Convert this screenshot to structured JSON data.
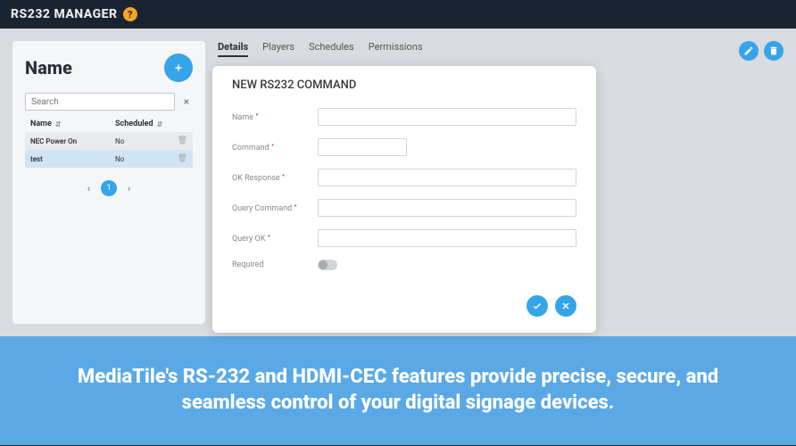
{
  "app": {
    "title": "RS232 MANAGER"
  },
  "leftPanel": {
    "title": "Name",
    "searchPlaceholder": "Search",
    "columns": {
      "name": "Name",
      "scheduled": "Scheduled"
    },
    "rows": [
      {
        "name": "NEC Power On",
        "scheduled": "No"
      },
      {
        "name": "test",
        "scheduled": "No"
      }
    ],
    "page": "1"
  },
  "tabs": {
    "details": "Details",
    "players": "Players",
    "schedules": "Schedules",
    "permissions": "Permissions"
  },
  "modal": {
    "title": "NEW RS232 COMMAND",
    "fields": {
      "name": "Name",
      "command": "Command",
      "okResponse": "OK Response",
      "queryCommand": "Query Command",
      "queryOk": "Query OK",
      "required": "Required"
    }
  },
  "banner": {
    "text": "MediaTile's RS-232 and HDMI-CEC features provide precise, secure, and seamless control of your digital signage devices."
  }
}
